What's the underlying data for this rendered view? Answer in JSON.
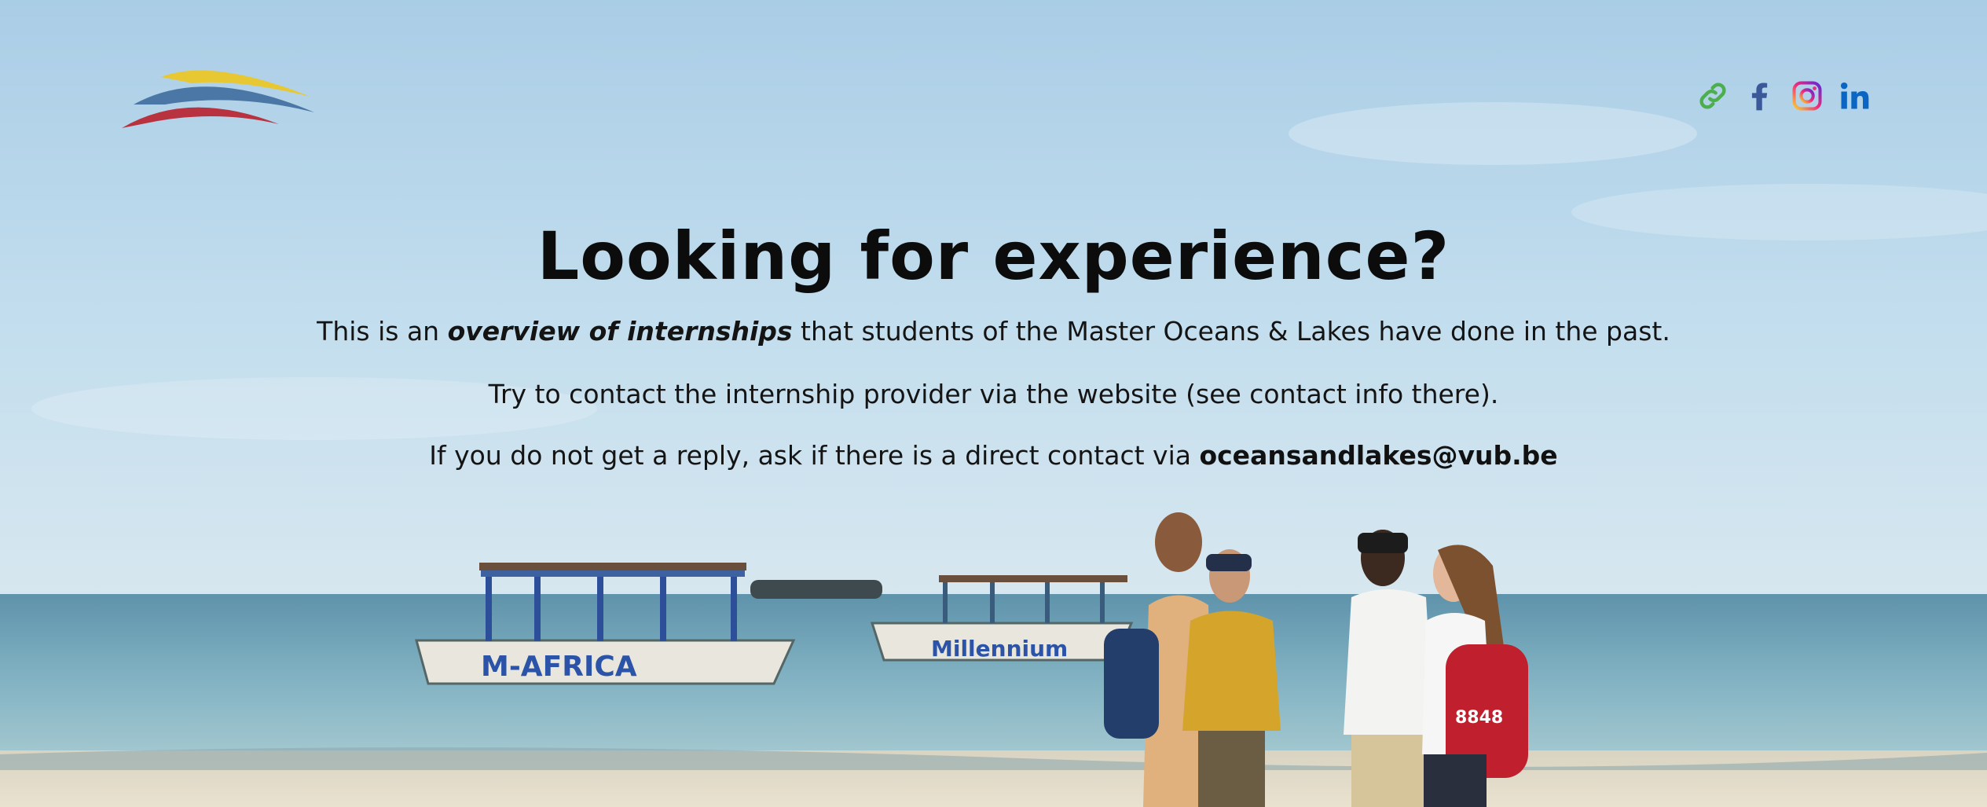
{
  "social": {
    "items": [
      {
        "icon": "link-icon",
        "color": "#4cae4c"
      },
      {
        "icon": "facebook-icon",
        "color": "#3b5998"
      },
      {
        "icon": "instagram-icon",
        "color": "#d62976"
      },
      {
        "icon": "linkedin-icon",
        "color": "#0a66c2"
      }
    ]
  },
  "hero": {
    "title": "Looking for experience?",
    "line1_prefix": "This is an ",
    "line1_emphasis": "overview of internships",
    "line1_suffix": " that students of the Master Oceans & Lakes have done in the past.",
    "line2": "Try to contact the internship provider via the website (see contact info there).",
    "line3_prefix": "If you do not get a reply, ask if there is a direct contact via ",
    "line3_email": "oceansandlakes@vub.be"
  },
  "boats": {
    "boat1_label": "M-AFRICA",
    "boat2_label": "Millennium"
  },
  "person": {
    "bag_text": "8848"
  },
  "colors": {
    "logo_yellow": "#e8c832",
    "logo_blue": "#4a77a6",
    "logo_red": "#b8323f"
  }
}
